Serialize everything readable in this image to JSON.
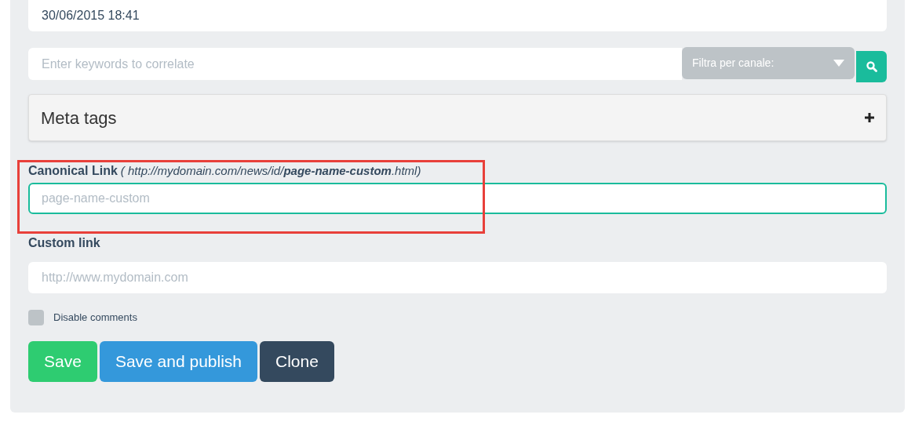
{
  "date_field": {
    "value": "30/06/2015 18:41"
  },
  "keywords": {
    "placeholder": "Enter keywords to correlate",
    "channel_filter": {
      "placeholder": "Filtra per canale:"
    }
  },
  "meta_tags": {
    "title": "Meta tags",
    "expanded": false
  },
  "canonical_link": {
    "label": "Canonical Link",
    "hint": "( http://mydomain.com/news/id/**page-name-custom**.html)",
    "placeholder": "page-name-custom",
    "focused": true,
    "highlighted": true
  },
  "custom_link": {
    "label": "Custom link",
    "placeholder": "http://www.mydomain.com"
  },
  "disable_comments": {
    "label": "Disable comments",
    "checked": false
  },
  "buttons": [
    {
      "label": "Save",
      "kind": "success"
    },
    {
      "label": "Save and publish",
      "kind": "primary"
    },
    {
      "label": "Clone",
      "kind": "dark"
    }
  ]
}
